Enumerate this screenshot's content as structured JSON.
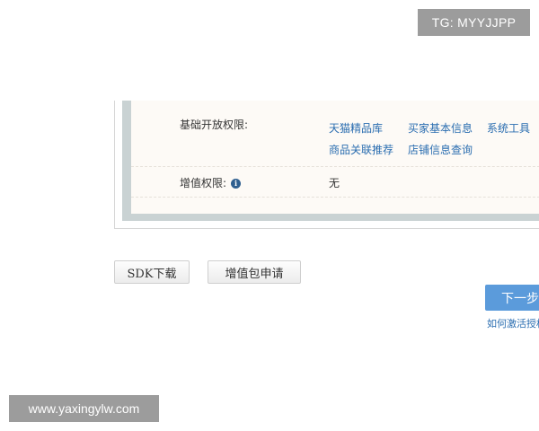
{
  "watermarks": {
    "top": "TG: MYYJJPP",
    "bottom": "www.yaxingylw.com"
  },
  "permissions": {
    "basic_label": "基础开放权限:",
    "basic_items": [
      "天猫精品库",
      "买家基本信息",
      "系统工具",
      "商品关联推荐",
      "店铺信息查询"
    ],
    "value_added_label": "增值权限:",
    "value_added_value": "无"
  },
  "buttons": {
    "sdk_download": "SDK下载",
    "apply_package": "增值包申请",
    "next_step": "下一步"
  },
  "help_link": "如何激活授权"
}
